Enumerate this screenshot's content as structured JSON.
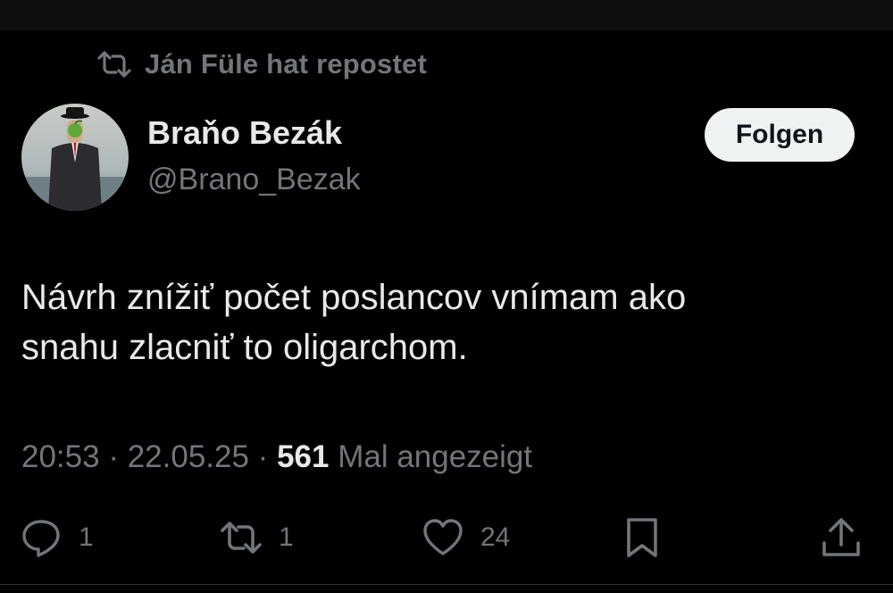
{
  "repost": {
    "text": "Ján Füle hat repostet"
  },
  "author": {
    "name": "Braňo Bezák",
    "handle": "@Brano_Bezak"
  },
  "follow_label": "Folgen",
  "tweet": {
    "lines": [
      "Návrh znížiť počet poslancov vnímam ako",
      "snahu zlacniť to oligarchom."
    ]
  },
  "meta": {
    "time": "20:53",
    "sep1": " · ",
    "date": "22.05.25",
    "sep2": " · ",
    "views": "561",
    "views_suffix": " Mal angezeigt"
  },
  "actions": {
    "replies": "1",
    "reposts": "1",
    "likes": "24"
  },
  "colors": {
    "background": "#000000",
    "text": "#e7e9ea",
    "secondary": "#71767b",
    "button_bg": "#eff3f4"
  },
  "icons": {
    "repost": "repost-icon",
    "reply": "reply-icon",
    "like": "heart-icon",
    "bookmark": "bookmark-icon",
    "share": "share-icon"
  }
}
